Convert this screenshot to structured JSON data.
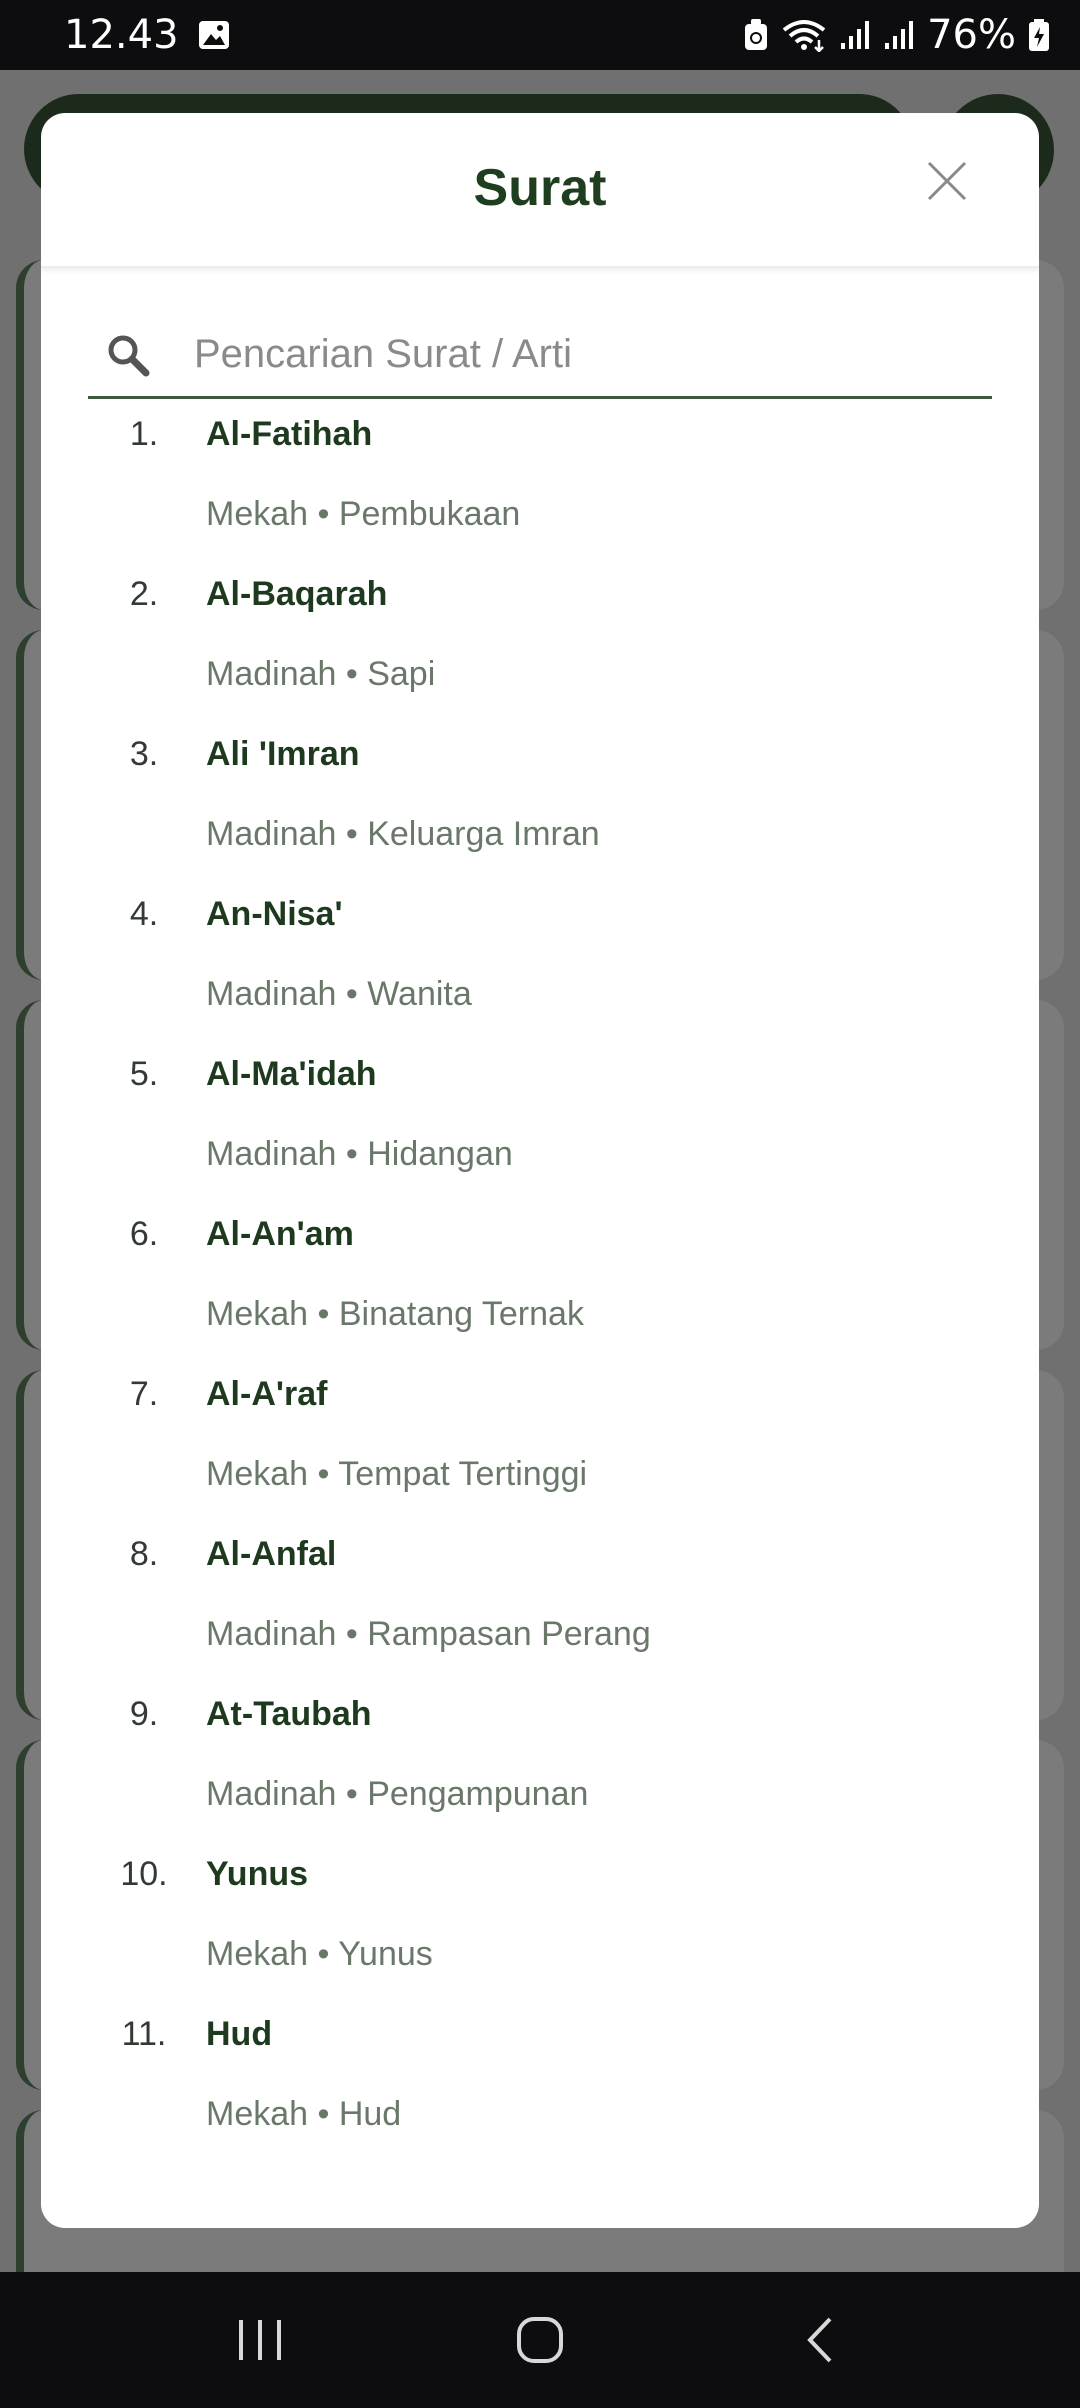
{
  "status_bar": {
    "time": "12.43",
    "battery": "76%",
    "icons": [
      "gallery-icon",
      "recycle-icon",
      "wifi-icon",
      "signal-icon",
      "signal-icon",
      "battery-icon"
    ]
  },
  "modal": {
    "title": "Surat",
    "search": {
      "placeholder": "Pencarian Surat / Arti",
      "value": ""
    },
    "items": [
      {
        "number": "1.",
        "name": "Al-Fatihah",
        "meta": "Mekah • Pembukaan"
      },
      {
        "number": "2.",
        "name": "Al-Baqarah",
        "meta": "Madinah • Sapi"
      },
      {
        "number": "3.",
        "name": "Ali 'Imran",
        "meta": "Madinah • Keluarga Imran"
      },
      {
        "number": "4.",
        "name": "An-Nisa'",
        "meta": "Madinah • Wanita"
      },
      {
        "number": "5.",
        "name": "Al-Ma'idah",
        "meta": "Madinah • Hidangan"
      },
      {
        "number": "6.",
        "name": "Al-An'am",
        "meta": "Mekah • Binatang Ternak"
      },
      {
        "number": "7.",
        "name": "Al-A'raf",
        "meta": "Mekah • Tempat Tertinggi"
      },
      {
        "number": "8.",
        "name": "Al-Anfal",
        "meta": "Madinah • Rampasan Perang"
      },
      {
        "number": "9.",
        "name": "At-Taubah",
        "meta": "Madinah • Pengampunan"
      },
      {
        "number": "10.",
        "name": "Yunus",
        "meta": "Mekah • Yunus"
      },
      {
        "number": "11.",
        "name": "Hud",
        "meta": "Mekah • Hud"
      }
    ]
  },
  "colors": {
    "accent": "#1e3a1e",
    "meta_text": "#6a786a",
    "scrim": "#707070"
  },
  "nav_bar": {
    "buttons": [
      "recents-icon",
      "home-icon",
      "back-icon"
    ]
  }
}
